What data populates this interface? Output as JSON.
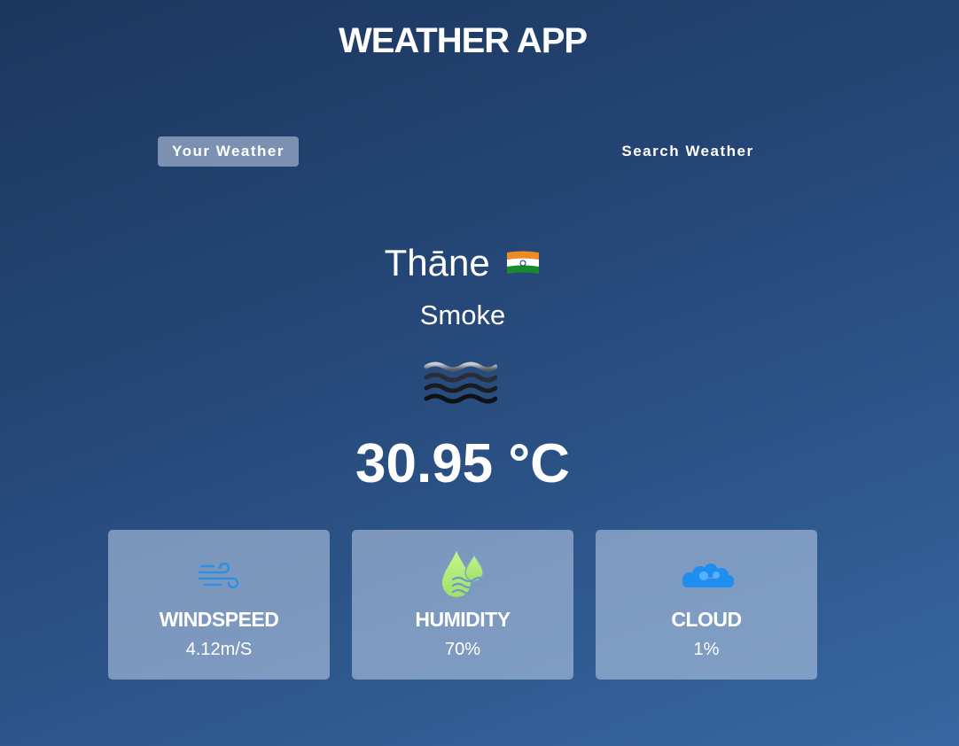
{
  "header": {
    "title": "WEATHER APP"
  },
  "tabs": [
    {
      "label": "Your Weather",
      "active": true
    },
    {
      "label": "Search Weather",
      "active": false
    }
  ],
  "location": {
    "city": "Thāne",
    "country_flag": "india-flag-icon"
  },
  "weather": {
    "condition": "Smoke",
    "icon": "smoke-haze-icon",
    "temperature": "30.95 °C"
  },
  "stats": [
    {
      "label": "WINDSPEED",
      "value": "4.12m/S",
      "icon": "wind-icon",
      "color": "#2f8fe0"
    },
    {
      "label": "HUMIDITY",
      "value": "70%",
      "icon": "humidity-drops-icon",
      "color": "#b8f07a"
    },
    {
      "label": "CLOUD",
      "value": "1%",
      "icon": "cloud-icon",
      "color": "#1e8ef0"
    }
  ],
  "colors": {
    "background_top": "#1c365e",
    "background_bottom": "#3667a0",
    "active_tab": "#8c9fc0",
    "card": "#8aa1c3"
  }
}
